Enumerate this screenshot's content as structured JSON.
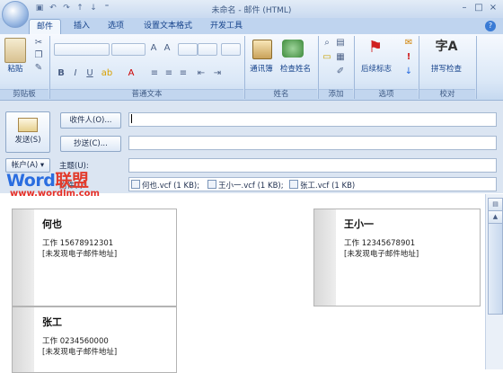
{
  "window": {
    "title": "未命名 - 邮件 (HTML)",
    "controls": [
      "–",
      "□",
      "×"
    ]
  },
  "ribbon": {
    "tabs": [
      {
        "label": "邮件",
        "active": true
      },
      {
        "label": "插入",
        "active": false
      },
      {
        "label": "选项",
        "active": false
      },
      {
        "label": "设置文本格式",
        "active": false
      },
      {
        "label": "开发工具",
        "active": false
      }
    ],
    "groups": {
      "clipboard": {
        "label": "剪贴板",
        "paste_label": "粘贴"
      },
      "basic_text": {
        "label": "普通文本"
      },
      "names": {
        "label": "姓名",
        "address_book": "通讯簿",
        "check_names": "检查姓名"
      },
      "include": {
        "label": "添加"
      },
      "options": {
        "label": "选项",
        "follow_up": "后续标志"
      },
      "proofing": {
        "label": "校对",
        "spelling": "拼写检查"
      }
    },
    "help_icon": "?"
  },
  "form": {
    "send_label": "发送(S)",
    "to_button": "收件人(O)...",
    "cc_button": "抄送(C)...",
    "account_button": "帐户(A)",
    "subject_label": "主题(U):",
    "attachments_label": "附件(I):",
    "to_value": "",
    "cc_value": "",
    "subject_value": ""
  },
  "attachments": [
    {
      "name": "何也.vcf (1 KB);"
    },
    {
      "name": "王小一.vcf (1 KB);"
    },
    {
      "name": "张工.vcf (1 KB)"
    }
  ],
  "cards": [
    {
      "name": "何也",
      "work": "工作 15678912301",
      "email": "[未发现电子邮件地址]"
    },
    {
      "name": "王小一",
      "work": "工作 12345678901",
      "email": "[未发现电子邮件地址]"
    },
    {
      "name": "张工",
      "work": "工作 0234560000",
      "email": "[未发现电子邮件地址]"
    }
  ],
  "watermark": {
    "brand_a": "Word",
    "brand_b": "联盟",
    "url": "www.wordlm.com"
  }
}
